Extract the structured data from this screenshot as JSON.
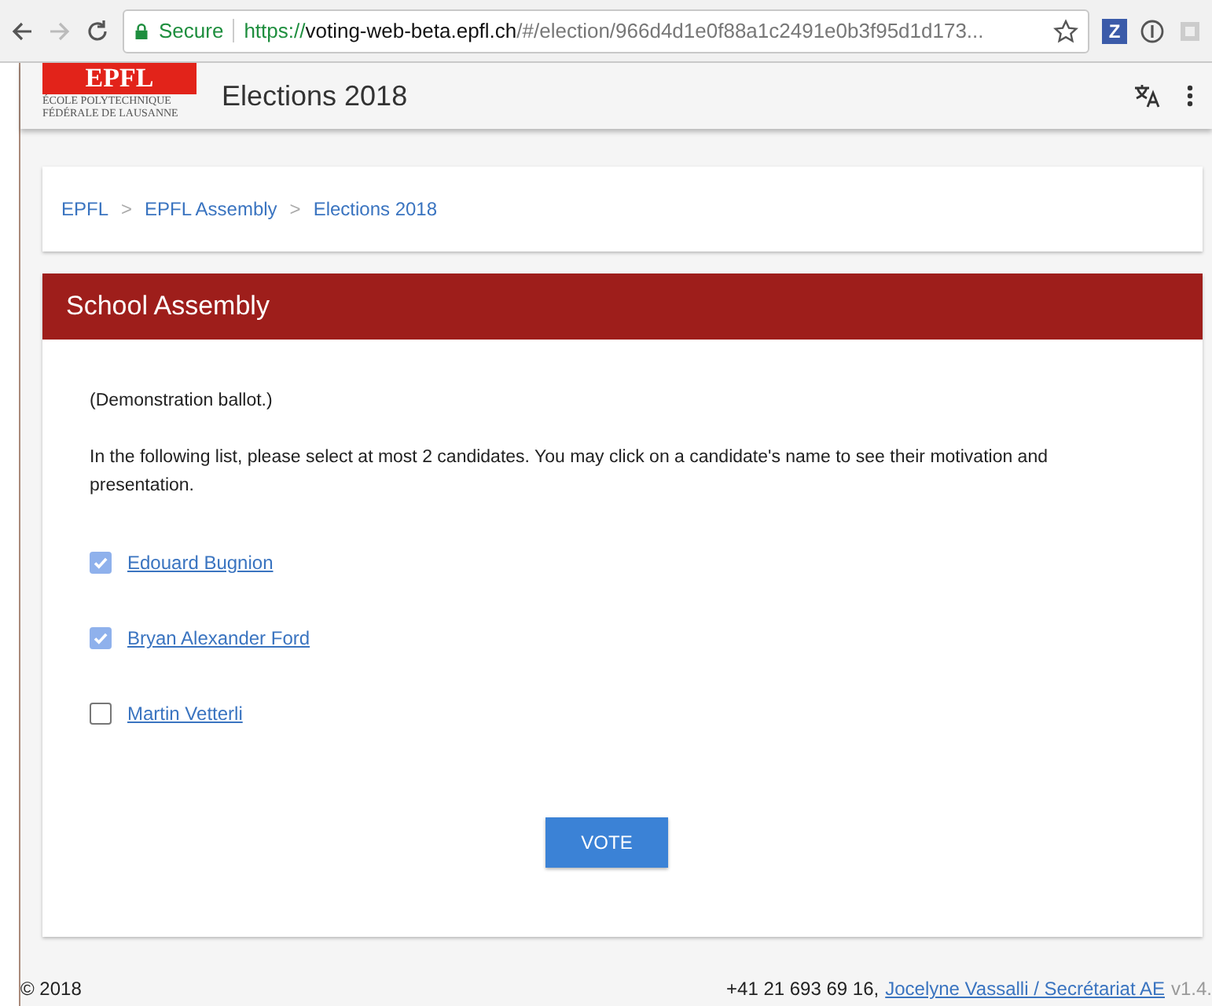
{
  "browser": {
    "secure_label": "Secure",
    "url": {
      "scheme": "https://",
      "host": "voting-web-beta.epfl.ch",
      "path": "/#/election/966d4d1e0f88a1c2491e0b3f95d1d173..."
    },
    "extension_badge": "Z"
  },
  "header": {
    "logo": {
      "mark": "EPFL",
      "line_1": "ÉCOLE POLYTECHNIQUE",
      "line_2": "FÉDÉRALE DE LAUSANNE"
    },
    "title": "Elections 2018"
  },
  "breadcrumb": {
    "items": [
      {
        "label": "EPFL"
      },
      {
        "label": "EPFL Assembly"
      },
      {
        "label": "Elections 2018"
      }
    ],
    "separator": ">"
  },
  "ballot": {
    "title": "School Assembly",
    "note": "(Demonstration ballot.)",
    "instructions": "In the following list, please select at most 2 candidates. You may click on a candidate's name to see their motivation and presentation.",
    "candidates": [
      {
        "name": "Edouard Bugnion",
        "checked": true
      },
      {
        "name": "Bryan Alexander Ford",
        "checked": true
      },
      {
        "name": "Martin Vetterli",
        "checked": false
      }
    ],
    "button": "VOTE"
  },
  "footer": {
    "copyright": "© 2018",
    "phone": "+41 21 693 69 16,",
    "contact_link": "Jocelyne Vassalli / Secrétariat AE",
    "version": "v1.4."
  }
}
